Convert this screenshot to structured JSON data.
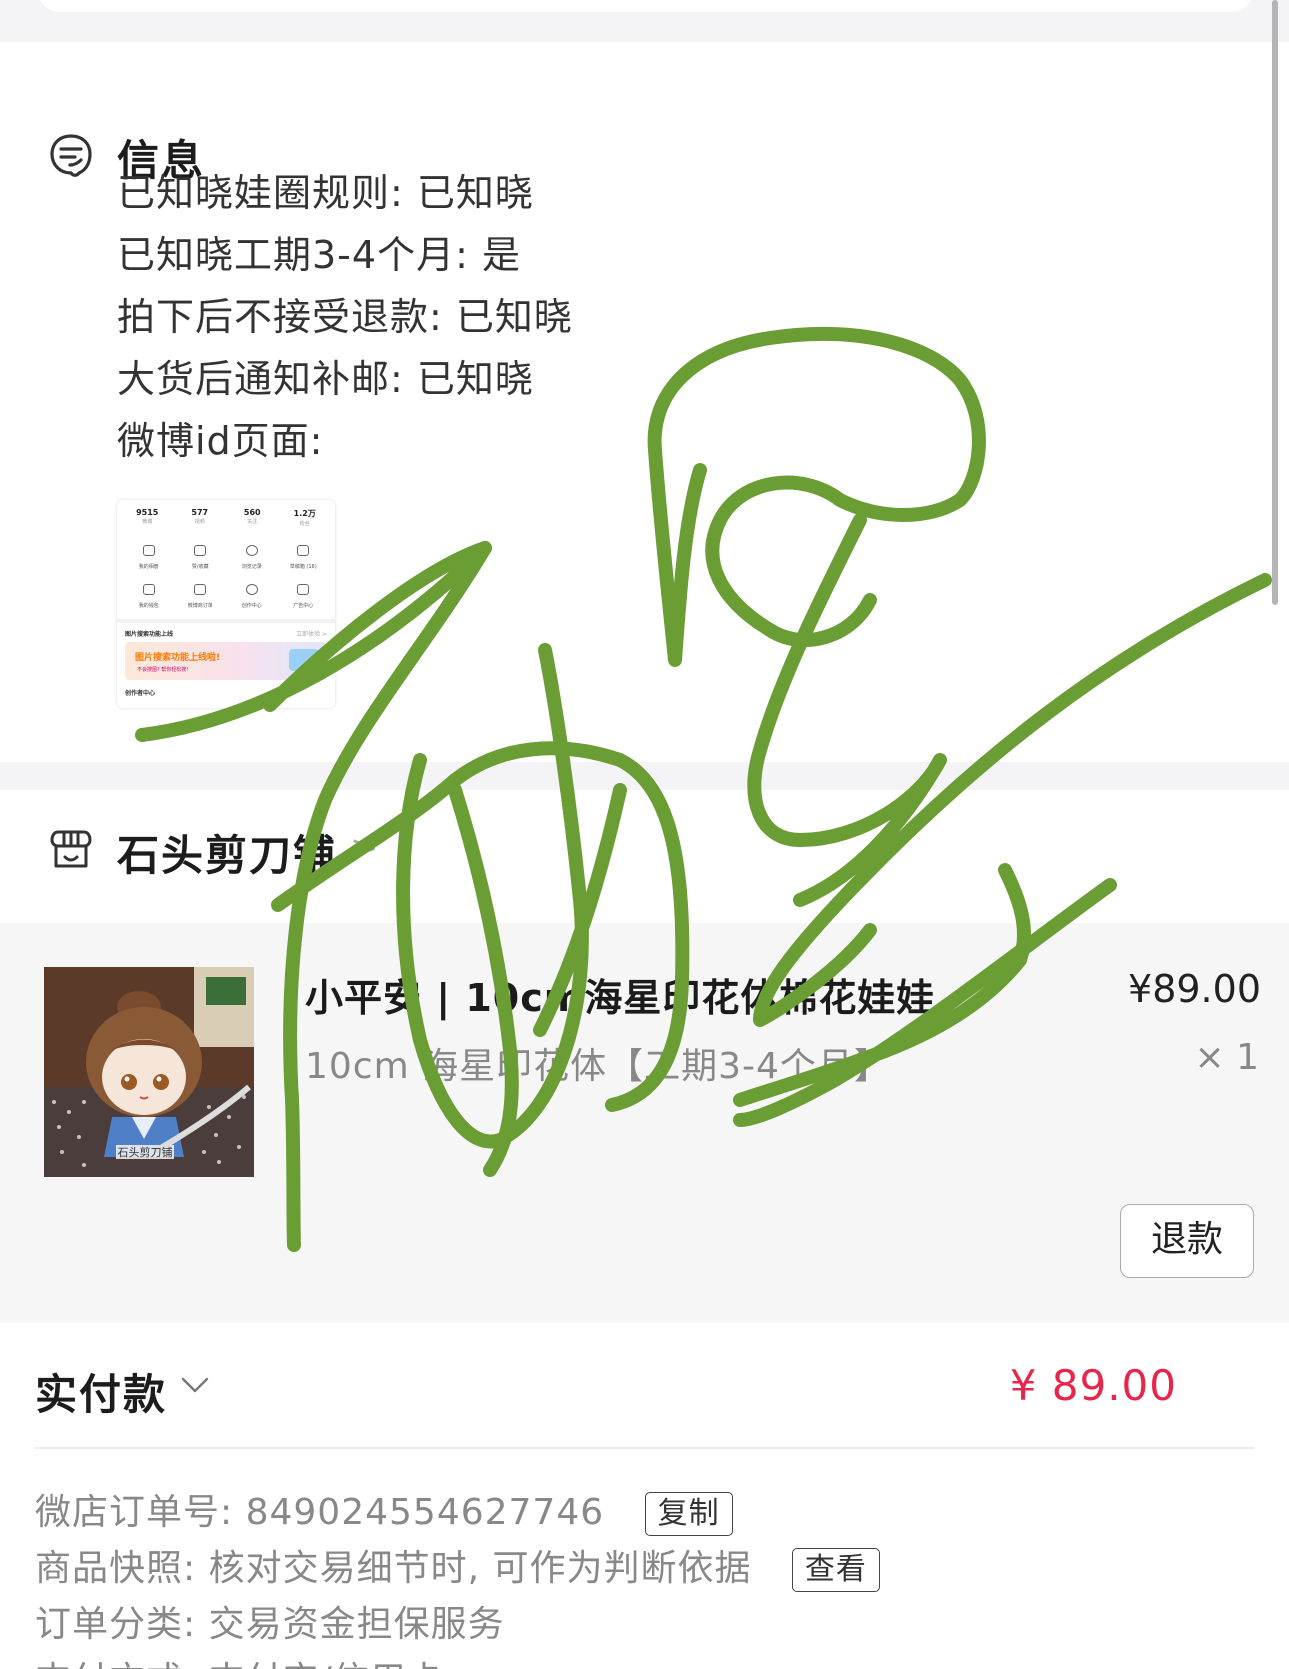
{
  "info": {
    "title": "信息",
    "lines": [
      "已知晓娃圈规则: 已知晓",
      "已知晓工期3-4个月: 是",
      "拍下后不接受退款: 已知晓",
      "大货后通知补邮: 已知晓",
      "微博id页面:"
    ],
    "weibo_screenshot": {
      "stats": [
        {
          "num": "9515",
          "label": "微博"
        },
        {
          "num": "577",
          "label": "视频"
        },
        {
          "num": "560",
          "label": "关注"
        },
        {
          "num": "1.2万",
          "label": "粉丝"
        }
      ],
      "grid": [
        "我的相册",
        "赞/收藏",
        "浏览记录",
        "草稿箱 (16)",
        "我的钱包",
        "微博商订单",
        "创作中心",
        "广告中心"
      ],
      "feature_row": {
        "left": "图片搜索功能上线",
        "right": "立即体验 >"
      },
      "banner_text": "图片搜索功能上线啦!",
      "banner_sub": "不会搜图? 帮你轻松搜!",
      "footer": "创作者中心"
    }
  },
  "shop": {
    "name": "石头剪刀铺",
    "chevron": ">"
  },
  "product": {
    "title": "小平安 | 10cm海星印花体棉花娃娃",
    "sku": "10cm 海星印花体【工期3-4个月】",
    "price": "¥89.00",
    "quantity": "× 1",
    "image_watermark": "石头剪刀铺",
    "refund_button": "退款"
  },
  "payment": {
    "label": "实付款",
    "amount": "¥ 89.00",
    "order_number_label": "微店订单号: ",
    "order_number": "849024554627746",
    "copy_button": "复制",
    "snapshot_label": "商品快照: 核对交易细节时, 可作为判断依据",
    "view_button": "查看",
    "category_line": "订单分类: 交易资金担保服务",
    "pay_method_line": "支付方式: 支付宝/信用卡"
  },
  "colors": {
    "accent_price": "#e8254b",
    "signature_green": "#6a9e35",
    "page_bg": "#f4f4f6",
    "product_bg": "#f6f6f6"
  },
  "icons": {
    "info": "message-info-icon",
    "shop": "shop-awning-icon",
    "pay_toggle": "chevron-down-icon"
  }
}
